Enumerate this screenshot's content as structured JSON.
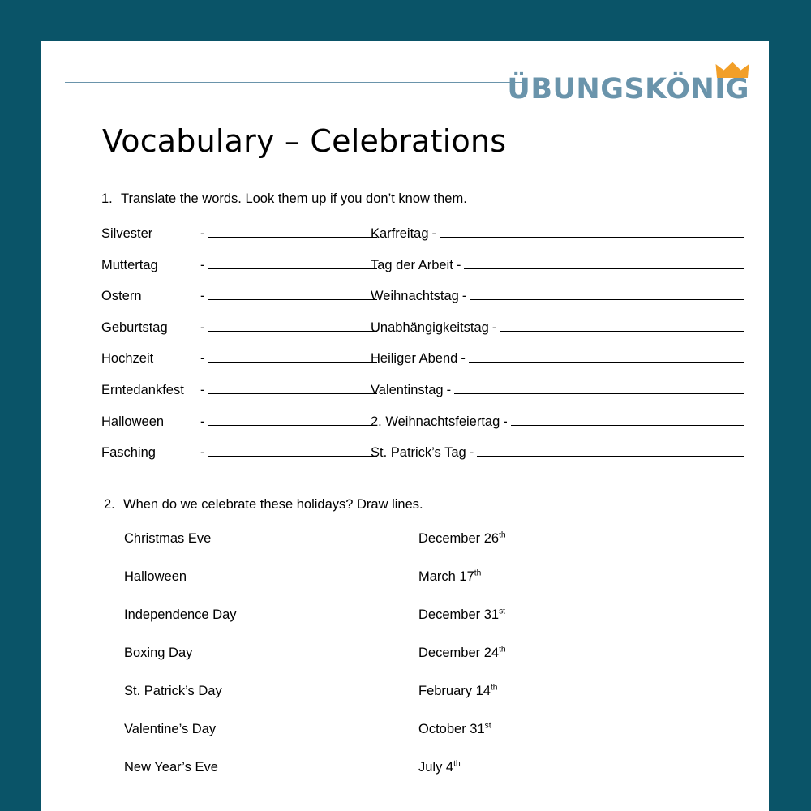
{
  "theme": {
    "background_color": "#0a5468",
    "page_color": "#ffffff",
    "logo_color": "#6a94ab",
    "crown_color": "#f29f28",
    "rule_color": "#6a94ab",
    "text_color": "#000000"
  },
  "header": {
    "logo_text": "ÜBUNGSKÖNIG",
    "crown_icon": "crown-icon",
    "rule": "horizontal-rule"
  },
  "title": "Vocabulary – Celebrations",
  "exercise1": {
    "number": "1.",
    "instruction": "Translate the words. Look them up if you don’t know them.",
    "dash": "-",
    "rows": [
      {
        "left": "Silvester",
        "right": "Karfreitag"
      },
      {
        "left": "Muttertag",
        "right": "Tag der Arbeit"
      },
      {
        "left": "Ostern",
        "right": "Weihnachtstag"
      },
      {
        "left": "Geburtstag",
        "right": "Unabhängigkeitstag"
      },
      {
        "left": "Hochzeit",
        "right": "Heiliger Abend"
      },
      {
        "left": "Erntedankfest",
        "right": "Valentinstag"
      },
      {
        "left": "Halloween",
        "right": "2. Weihnachtsfeiertag"
      },
      {
        "left": "Fasching",
        "right": "St. Patrick’s Tag"
      }
    ]
  },
  "exercise2": {
    "number": "2.",
    "instruction": "When do we celebrate these holidays? Draw lines.",
    "rows": [
      {
        "holiday": "Christmas Eve",
        "date_text": "December 26",
        "ordinal": "th"
      },
      {
        "holiday": "Halloween",
        "date_text": "March 17",
        "ordinal": "th"
      },
      {
        "holiday": "Independence Day",
        "date_text": "December 31",
        "ordinal": "st"
      },
      {
        "holiday": "Boxing Day",
        "date_text": "December 24",
        "ordinal": "th"
      },
      {
        "holiday": "St. Patrick’s Day",
        "date_text": "February 14",
        "ordinal": "th"
      },
      {
        "holiday": "Valentine’s Day",
        "date_text": "October 31",
        "ordinal": "st"
      },
      {
        "holiday": "New Year’s Eve",
        "date_text": "July 4",
        "ordinal": "th"
      }
    ]
  }
}
